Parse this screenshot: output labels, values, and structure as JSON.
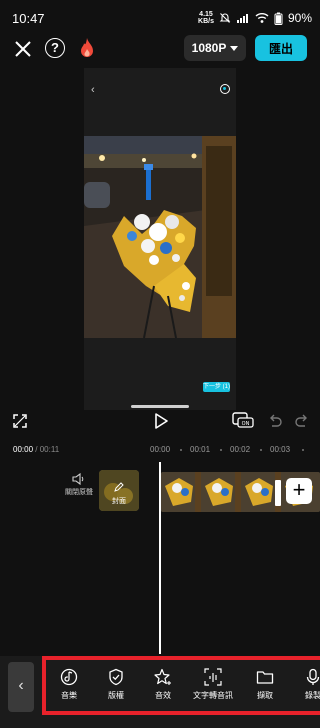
{
  "status": {
    "time": "10:47",
    "speed_top": "4.15",
    "speed_bottom": "KB/s",
    "battery": "90%"
  },
  "toolbar": {
    "resolution": "1080P",
    "export_label": "匯出"
  },
  "preview": {
    "next_label": "下一步 (1)"
  },
  "timeline": {
    "current_time": "00:00",
    "total_time": "/ 00:11",
    "ruler": [
      "00:00",
      "00:01",
      "00:02",
      "00:03"
    ],
    "audio_toggle_label": "關閉原聲",
    "cover_label": "封面"
  },
  "bottom_tools": [
    {
      "label": "音樂",
      "icon": "music-note-icon"
    },
    {
      "label": "版權",
      "icon": "shield-check-icon"
    },
    {
      "label": "音效",
      "icon": "sparkle-star-icon"
    },
    {
      "label": "文字轉音訊",
      "icon": "text-to-audio-icon"
    },
    {
      "label": "擷取",
      "icon": "folder-icon"
    },
    {
      "label": "錄製",
      "icon": "microphone-icon"
    }
  ],
  "colors": {
    "accent": "#18c2e0",
    "highlight_frame": "#e8222b",
    "background": "#111111"
  }
}
